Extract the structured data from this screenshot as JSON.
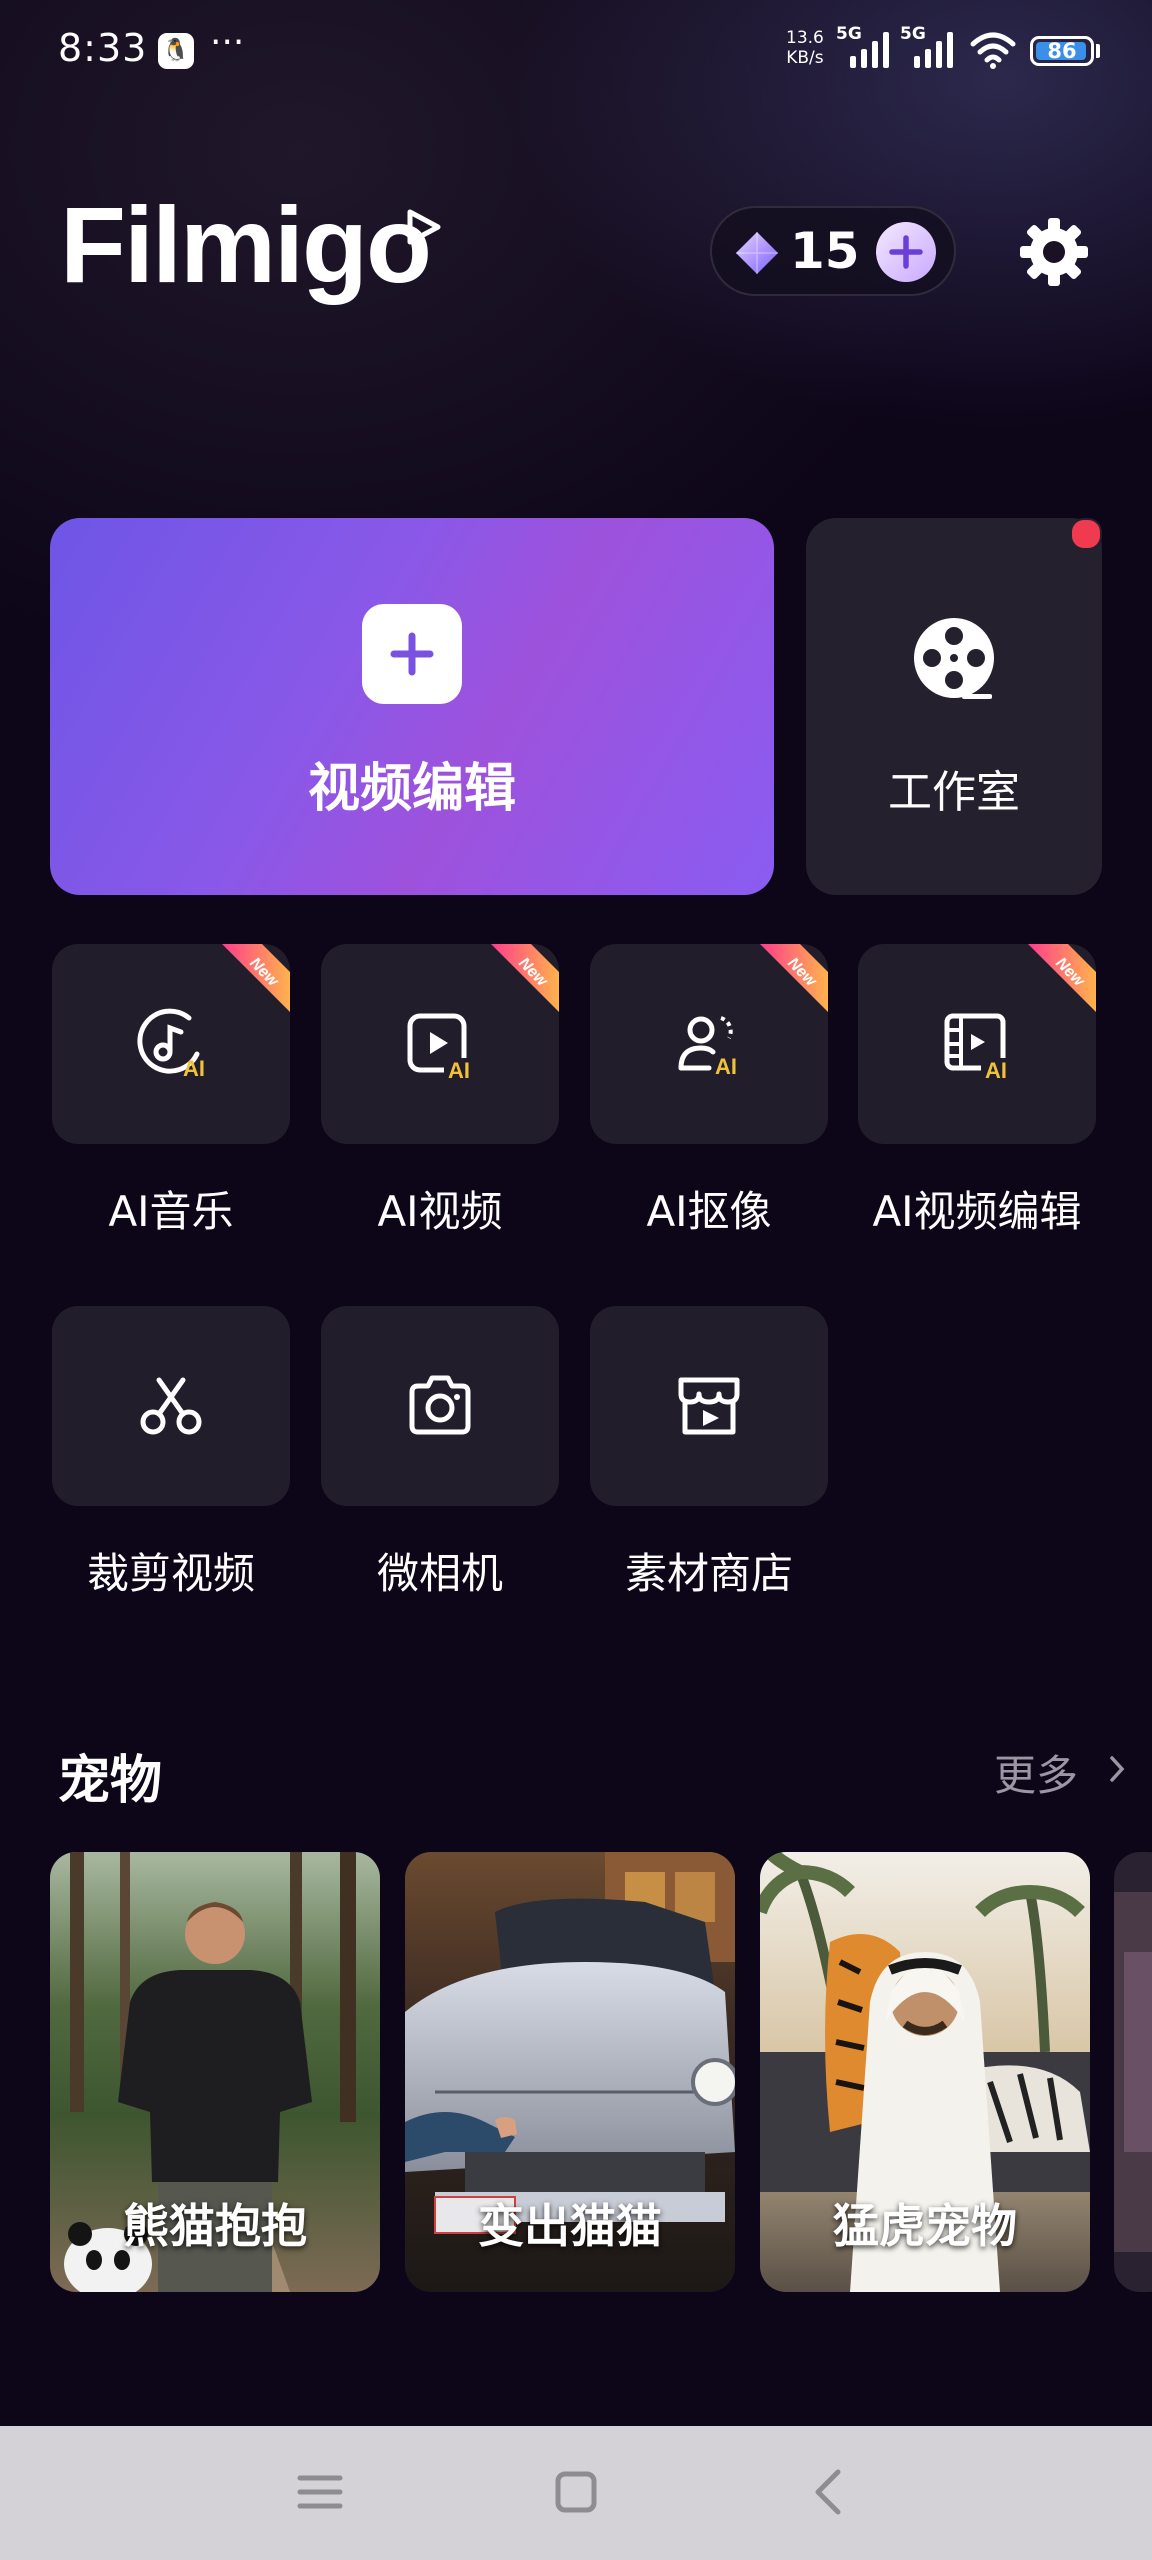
{
  "status_bar": {
    "time": "8:33",
    "net_speed": "13.6",
    "net_unit": "KB/s",
    "sim1": "5G",
    "sim2": "5G",
    "battery": "86",
    "more": "···"
  },
  "header": {
    "logo": "Filmigo",
    "credits": "15"
  },
  "cards": {
    "edit_label": "视频编辑",
    "studio_label": "工作室"
  },
  "badge_text": "New",
  "ai_tools": [
    {
      "label": "AI音乐",
      "icon": "ai-music-icon"
    },
    {
      "label": "AI视频",
      "icon": "ai-video-icon"
    },
    {
      "label": "AI抠像",
      "icon": "ai-cutout-icon"
    },
    {
      "label": "AI视频编辑",
      "icon": "ai-video-edit-icon"
    }
  ],
  "tools": [
    {
      "label": "裁剪视频",
      "icon": "scissors-icon"
    },
    {
      "label": "微相机",
      "icon": "camera-icon"
    },
    {
      "label": "素材商店",
      "icon": "store-icon"
    }
  ],
  "section": {
    "title": "宠物",
    "more": "更多",
    "items": [
      {
        "label": "熊猫抱抱"
      },
      {
        "label": "变出猫猫"
      },
      {
        "label": "猛虎宠物"
      }
    ]
  },
  "colors": {
    "accent": "#8a58e8",
    "background": "#0d0518",
    "tile": "#221d2b",
    "notification": "#f03a4f"
  }
}
